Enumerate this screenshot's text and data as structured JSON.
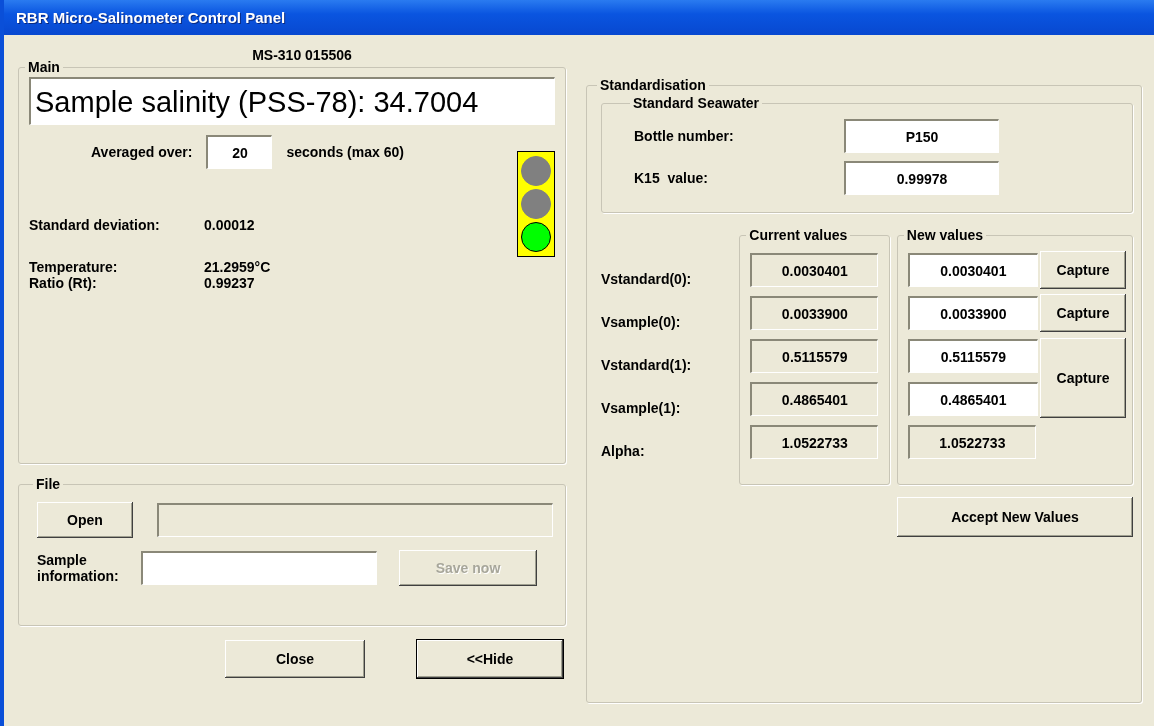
{
  "window": {
    "title": "RBR Micro-Salinometer Control Panel"
  },
  "device_id": "MS-310 015506",
  "main": {
    "title": "Main",
    "salinity": "Sample salinity (PSS-78): 34.7004",
    "averaging": {
      "label": "Averaged over:",
      "value": "20",
      "unit": "seconds (max 60)"
    },
    "traffic_light": [
      {
        "color": "#808080"
      },
      {
        "color": "#808080"
      },
      {
        "color": "#00ff00"
      }
    ],
    "reading_groups": [
      {
        "items": [
          {
            "label": "Standard deviation:",
            "value": "0.00012"
          }
        ]
      },
      {
        "items": [
          {
            "label": "Temperature:",
            "value": "21.2959°C"
          },
          {
            "label": "Ratio (Rt):",
            "value": "0.99237"
          }
        ]
      }
    ]
  },
  "file": {
    "title": "File",
    "open_button": "Open",
    "sample_label": "Sample information:",
    "save_button": {
      "label": "Save now",
      "disabled": true
    }
  },
  "buttons": [
    {
      "label": "Close",
      "default": false
    },
    {
      "label": "<<Hide",
      "default": true
    }
  ],
  "standardisation": {
    "title": "Standardisation",
    "seawater": {
      "title": "Standard Seawater",
      "fields": [
        {
          "label": "Bottle number:",
          "value": "P150"
        },
        {
          "label": "K15  value:",
          "value": "0.99978"
        }
      ]
    },
    "current_title": "Current values",
    "new_title": "New values",
    "rows": [
      {
        "label": "Vstandard(0):",
        "current": "0.0030401",
        "new": "0.0030401",
        "editable": true
      },
      {
        "label": "Vsample(0):",
        "current": "0.0033900",
        "new": "0.0033900",
        "editable": true
      },
      {
        "label": "Vstandard(1):",
        "current": "0.5115579",
        "new": "0.5115579",
        "editable": true
      },
      {
        "label": "Vsample(1):",
        "current": "0.4865401",
        "new": "0.4865401",
        "editable": true
      },
      {
        "label": "Alpha:",
        "current": "1.0522733",
        "new": "1.0522733",
        "editable": false
      }
    ],
    "capture_buttons": [
      {
        "label": "Capture",
        "kind": "single"
      },
      {
        "label": "Capture",
        "kind": "single"
      },
      {
        "label": "Capture",
        "kind": "double"
      }
    ],
    "accept_button": "Accept New Values"
  }
}
